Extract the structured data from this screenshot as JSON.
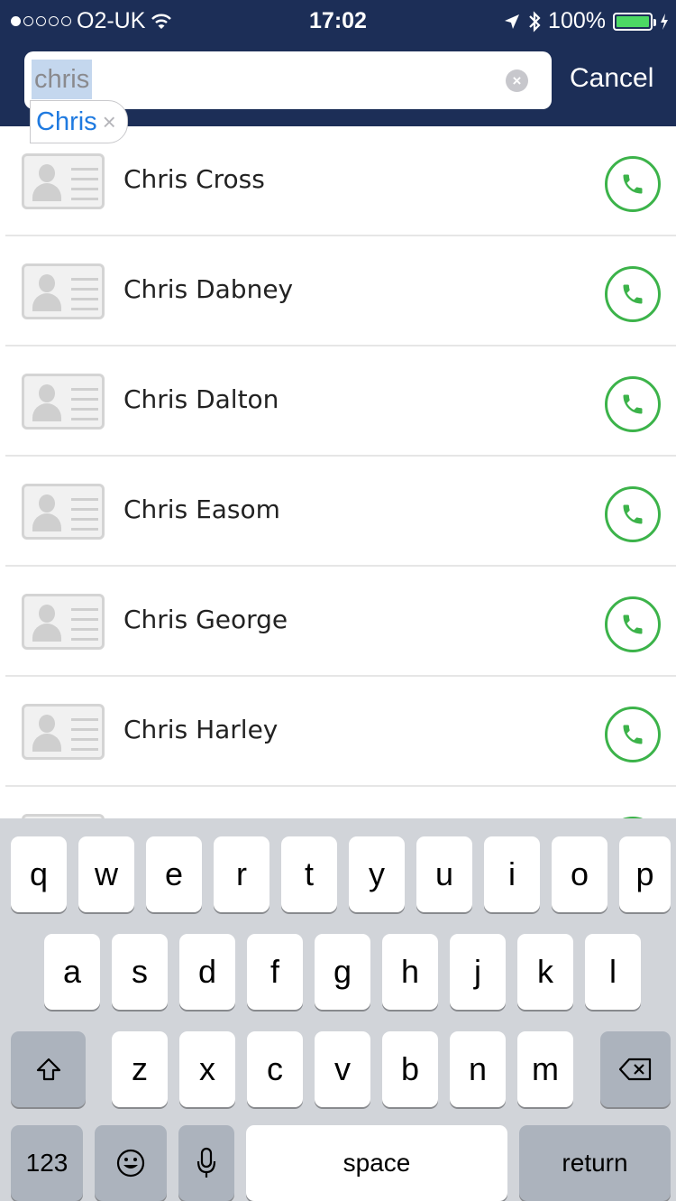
{
  "status_bar": {
    "carrier": "O2-UK",
    "time": "17:02",
    "battery": "100%"
  },
  "search": {
    "value": "chris",
    "cancel_label": "Cancel",
    "suggestion": "Chris"
  },
  "contacts": [
    {
      "name": "Chris Cross"
    },
    {
      "name": "Chris Dabney"
    },
    {
      "name": "Chris Dalton"
    },
    {
      "name": "Chris Easom"
    },
    {
      "name": "Chris George"
    },
    {
      "name": "Chris Harley"
    }
  ],
  "keyboard": {
    "row1": [
      "q",
      "w",
      "e",
      "r",
      "t",
      "y",
      "u",
      "i",
      "o",
      "p"
    ],
    "row2": [
      "a",
      "s",
      "d",
      "f",
      "g",
      "h",
      "j",
      "k",
      "l"
    ],
    "row3": [
      "z",
      "x",
      "c",
      "v",
      "b",
      "n",
      "m"
    ],
    "numbers_label": "123",
    "space_label": "space",
    "return_label": "return"
  },
  "colors": {
    "header": "#1c2e57",
    "call_green": "#3cb34a",
    "chip_blue": "#1f7ae0"
  },
  "icons": [
    "wifi-icon",
    "location-arrow-icon",
    "bluetooth-icon",
    "battery-icon",
    "clear-icon",
    "contact-card-icon",
    "phone-icon",
    "shift-icon",
    "backspace-icon",
    "emoji-icon",
    "microphone-icon"
  ]
}
